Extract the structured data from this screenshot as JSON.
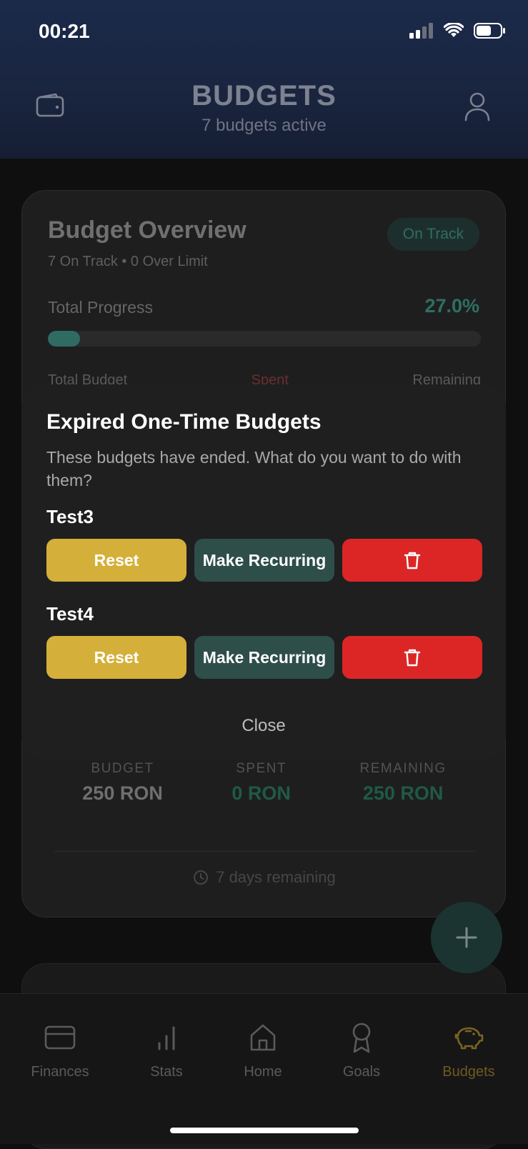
{
  "status_bar": {
    "time": "00:21"
  },
  "header": {
    "title": "BUDGETS",
    "subtitle": "7 budgets active",
    "wallet_icon": "wallet-icon",
    "profile_icon": "user-icon"
  },
  "overview": {
    "title": "Budget Overview",
    "summary": "7 On Track • 0 Over Limit",
    "status_badge": "On Track",
    "progress_label": "Total Progress",
    "progress_value": "27.0%",
    "progress_fraction": 0.075,
    "partial_labels": [
      "Total Budget",
      "Spent",
      "Remaining"
    ]
  },
  "budget_card": {
    "stats": [
      {
        "caption": "BUDGET",
        "value": "250 RON",
        "color": "#7a7a7a"
      },
      {
        "caption": "SPENT",
        "value": "0 RON",
        "color": "#1f5a45"
      },
      {
        "caption": "REMAINING",
        "value": "250 RON",
        "color": "#1f5a45"
      }
    ],
    "days_remaining": "7 days remaining"
  },
  "modal": {
    "title": "Expired One-Time Budgets",
    "description": "These budgets have ended. What do you want to do with them?",
    "budgets": [
      {
        "name": "Test3",
        "reset_label": "Reset",
        "recurring_label": "Make Recurring",
        "delete_icon": "trash-icon"
      },
      {
        "name": "Test4",
        "reset_label": "Reset",
        "recurring_label": "Make Recurring",
        "delete_icon": "trash-icon"
      }
    ],
    "close_label": "Close"
  },
  "tabbar": {
    "tabs": [
      {
        "label": "Finances",
        "icon": "card-icon"
      },
      {
        "label": "Stats",
        "icon": "bar-chart-icon"
      },
      {
        "label": "Home",
        "icon": "home-icon"
      },
      {
        "label": "Goals",
        "icon": "award-icon"
      },
      {
        "label": "Budgets",
        "icon": "piggy-bank-icon",
        "active": true
      }
    ]
  },
  "colors": {
    "accent_teal": "#2e6f62",
    "reset_yellow": "#d4b03a",
    "recurring_teal": "#2e4e4a",
    "delete_red": "#dc2626",
    "active_tab": "#6e5a1f"
  }
}
